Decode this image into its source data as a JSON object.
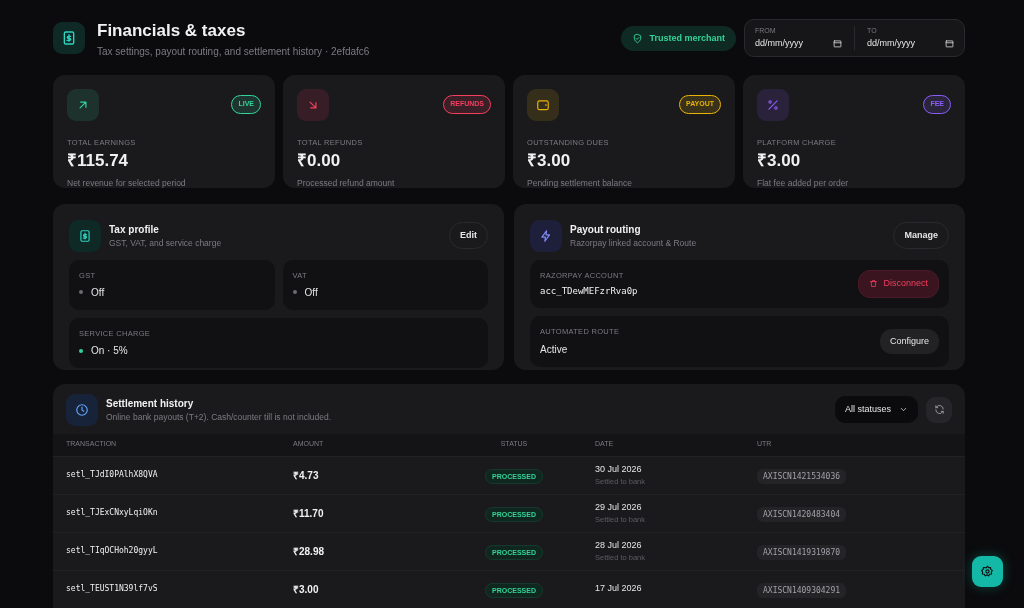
{
  "header": {
    "title": "Financials & taxes",
    "subtitle": "Tax settings, payout routing, and settlement history · 2efdafc6",
    "badge": "Trusted merchant",
    "date_range": [
      {
        "label": "FROM",
        "placeholder": "dd/mm/yyyy"
      },
      {
        "label": "TO",
        "placeholder": "dd/mm/yyyy"
      }
    ]
  },
  "stats": [
    {
      "kind": "up",
      "tag": "LIVE",
      "color": "#34d399",
      "label": "TOTAL EARNINGS",
      "value": "₹115.74",
      "note": "Net revenue for selected period"
    },
    {
      "kind": "down",
      "tag": "REFUNDS",
      "color": "#f43f5e",
      "label": "TOTAL REFUNDS",
      "value": "₹0.00",
      "note": "Processed refund amount"
    },
    {
      "kind": "wallet",
      "tag": "PAYOUT",
      "color": "#eab308",
      "label": "OUTSTANDING DUES",
      "value": "₹3.00",
      "note": "Pending settlement balance"
    },
    {
      "kind": "percent",
      "tag": "FEE",
      "color": "#8b5cf6",
      "label": "PLATFORM CHARGE",
      "value": "₹3.00",
      "note": "Flat fee added per order"
    }
  ],
  "tax_profile": {
    "title": "Tax profile",
    "subtitle": "GST, VAT, and service charge",
    "button": "Edit",
    "fields": [
      {
        "label": "GST",
        "value": "Off",
        "on": false
      },
      {
        "label": "VAT",
        "value": "Off",
        "on": false
      },
      {
        "label": "SERVICE CHARGE",
        "value": "On · 5%",
        "on": true
      }
    ]
  },
  "payout_routing": {
    "title": "Payout routing",
    "subtitle": "Razorpay linked account & Route",
    "button": "Manage",
    "rows": [
      {
        "label": "RAZORPAY ACCOUNT",
        "value": "acc_TDewMEFzrRva0p",
        "kind": "danger",
        "action": "Disconnect"
      },
      {
        "label": "AUTOMATED ROUTE",
        "value": "Active",
        "kind": "plain",
        "action": "Configure"
      }
    ]
  },
  "settlement": {
    "title": "Settlement history",
    "subtitle": "Online bank payouts (T+2). Cash/counter till is not included.",
    "filter": "All statuses",
    "columns": [
      "TRANSACTION",
      "AMOUNT",
      "STATUS",
      "DATE",
      "UTR"
    ],
    "rows": [
      {
        "transaction": "setl_TJdI0PAlhX8QVA",
        "amount": "₹4.73",
        "status": "PROCESSED",
        "date": "30 Jul 2026",
        "note": "Settled to bank",
        "utr": "AXISCN1421534036"
      },
      {
        "transaction": "setl_TJExCNxyLqiOKn",
        "amount": "₹11.70",
        "status": "PROCESSED",
        "date": "29 Jul 2026",
        "note": "Settled to bank",
        "utr": "AXISCN1420483404"
      },
      {
        "transaction": "setl_TIqOCHoh20gyyL",
        "amount": "₹28.98",
        "status": "PROCESSED",
        "date": "28 Jul 2026",
        "note": "Settled to bank",
        "utr": "AXISCN1419319870"
      },
      {
        "transaction": "setl_TEUST1N39lf7vS",
        "amount": "₹3.00",
        "status": "PROCESSED",
        "date": "17 Jul 2026",
        "utr": "AXISCN1409304291"
      }
    ]
  }
}
